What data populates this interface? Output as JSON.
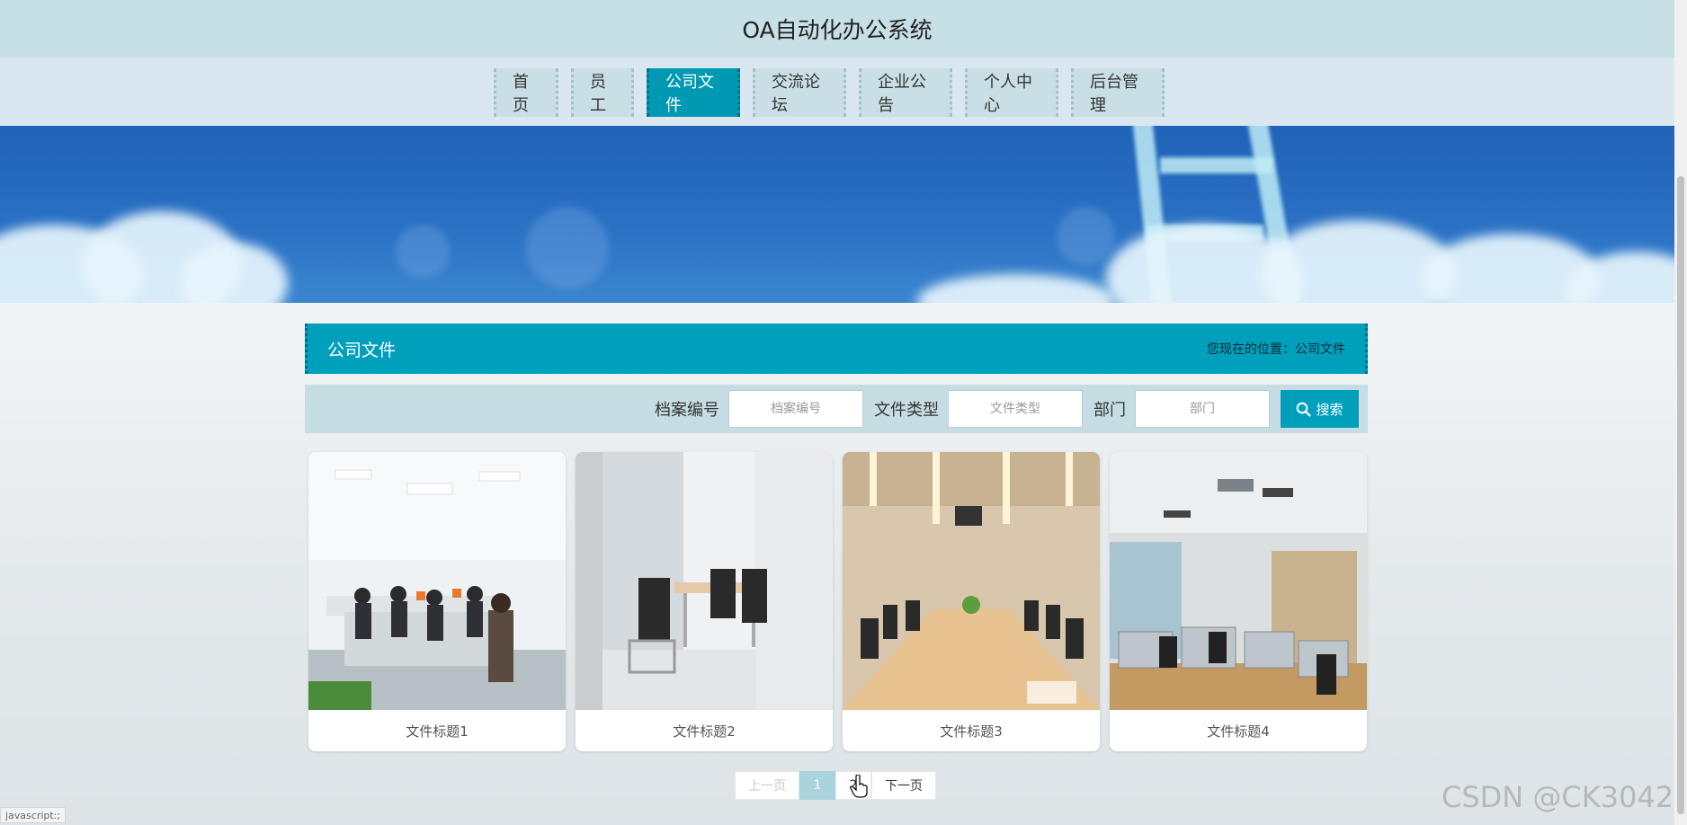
{
  "app": {
    "title": "OA自动化办公系统"
  },
  "nav": {
    "items": [
      {
        "label": "首页"
      },
      {
        "label": "员工"
      },
      {
        "label": "公司文件",
        "active": true
      },
      {
        "label": "交流论坛"
      },
      {
        "label": "企业公告"
      },
      {
        "label": "个人中心"
      },
      {
        "label": "后台管理"
      }
    ]
  },
  "section": {
    "title": "公司文件",
    "breadcrumb": "您现在的位置：公司文件"
  },
  "search": {
    "fields": [
      {
        "label": "档案编号",
        "placeholder": "档案编号"
      },
      {
        "label": "文件类型",
        "placeholder": "文件类型"
      },
      {
        "label": "部门",
        "placeholder": "部门"
      }
    ],
    "button_label": "搜索",
    "button_icon": "search-icon"
  },
  "cards": [
    {
      "title": "文件标题1",
      "image": "open-office-with-staff"
    },
    {
      "title": "文件标题2",
      "image": "small-meeting-room"
    },
    {
      "title": "文件标题3",
      "image": "conference-room"
    },
    {
      "title": "文件标题4",
      "image": "office-cubicles"
    }
  ],
  "pagination": {
    "prev": "上一页",
    "pages": [
      "1",
      "2"
    ],
    "current": "1",
    "next": "下一页"
  },
  "watermark": "CSDN @CK3042",
  "status_link": "javascript:;",
  "colors": {
    "accent": "#00a0bd",
    "nav_bg": "#c9dfe5",
    "topbar_bg": "#c7e0e6"
  }
}
